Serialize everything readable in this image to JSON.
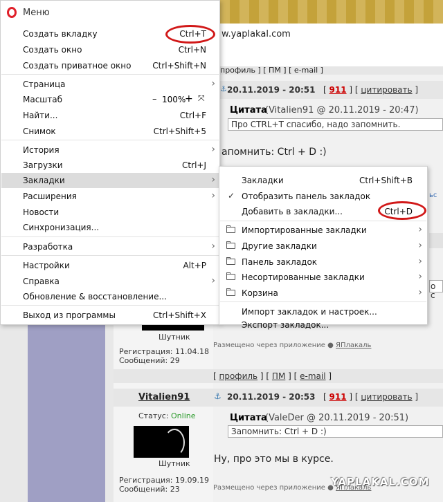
{
  "browser": {
    "url": "w.yaplakal.com"
  },
  "menu": {
    "title": "Меню",
    "items": [
      {
        "label": "Создать вкладку",
        "shortcut": "Ctrl+T"
      },
      {
        "label": "Создать окно",
        "shortcut": "Ctrl+N"
      },
      {
        "label": "Создать приватное окно",
        "shortcut": "Ctrl+Shift+N"
      },
      {
        "label": "Страница"
      },
      {
        "label": "Масштаб",
        "zoom_minus": "–",
        "zoom_value": "100%",
        "zoom_plus": "+"
      },
      {
        "label": "Найти...",
        "shortcut": "Ctrl+F"
      },
      {
        "label": "Снимок",
        "shortcut": "Ctrl+Shift+5"
      },
      {
        "label": "История"
      },
      {
        "label": "Загрузки",
        "shortcut": "Ctrl+J"
      },
      {
        "label": "Закладки"
      },
      {
        "label": "Расширения"
      },
      {
        "label": "Новости"
      },
      {
        "label": "Синхронизация..."
      },
      {
        "label": "Разработка"
      },
      {
        "label": "Настройки",
        "shortcut": "Alt+P"
      },
      {
        "label": "Справка"
      },
      {
        "label": "Обновление & восстановление..."
      },
      {
        "label": "Выход из программы",
        "shortcut": "Ctrl+Shift+X"
      }
    ]
  },
  "bookmarks_menu": {
    "items": [
      {
        "label": "Закладки",
        "shortcut": "Ctrl+Shift+B"
      },
      {
        "label": "Отобразить панель закладок",
        "check": "✓"
      },
      {
        "label": "Добавить в закладки...",
        "shortcut": "Ctrl+D"
      },
      {
        "label": "Импортированные закладки"
      },
      {
        "label": "Другие закладки"
      },
      {
        "label": "Панель закладок"
      },
      {
        "label": "Несортированные закладки"
      },
      {
        "label": "Корзина"
      },
      {
        "label": "Импорт закладок и настроек..."
      },
      {
        "label": "Экспорт закладок..."
      }
    ]
  },
  "forum": {
    "links_top": "профиль ] [ ПМ ] [ e-mail ]",
    "post1": {
      "date": "20.11.2019 - 20:51",
      "num": "911",
      "quote_link": "цитировать",
      "quote_title": "Цитата",
      "quote_by": "(Vitalien91 @ 20.11.2019 - 20:47)",
      "quote_text": "Про CTRL+T спасибо, надо запомнить.",
      "body": "апомнить: Ctrl + D :)"
    },
    "post2_user": {
      "rank": "Шутник",
      "reg": "Регистрация: 11.04.18",
      "msgs": "Сообщений: 29",
      "via": "Размещено через приложение",
      "app": "ЯПлакаль"
    },
    "links_row": {
      "profile": "профиль",
      "pm": "ПМ",
      "email": "e-mail"
    },
    "post3": {
      "username": "Vitalien91",
      "status_label": "Статус:",
      "status_value": "Online",
      "rank": "Шутник",
      "reg": "Регистрация: 19.09.19",
      "msgs": "Сообщений: 23",
      "date": "20.11.2019 - 20:53",
      "num": "911",
      "quote_link": "цитировать",
      "quote_title": "Цитата",
      "quote_by": "(ValeDer @ 20.11.2019 - 20:51)",
      "quote_text": "Запомнить: Ctrl + D :)",
      "body": "Ну, про это мы в курсе.",
      "via": "Размещено через приложение",
      "app": "ЯПлакаль"
    },
    "watermark": "YAPLAKAL.COM"
  }
}
